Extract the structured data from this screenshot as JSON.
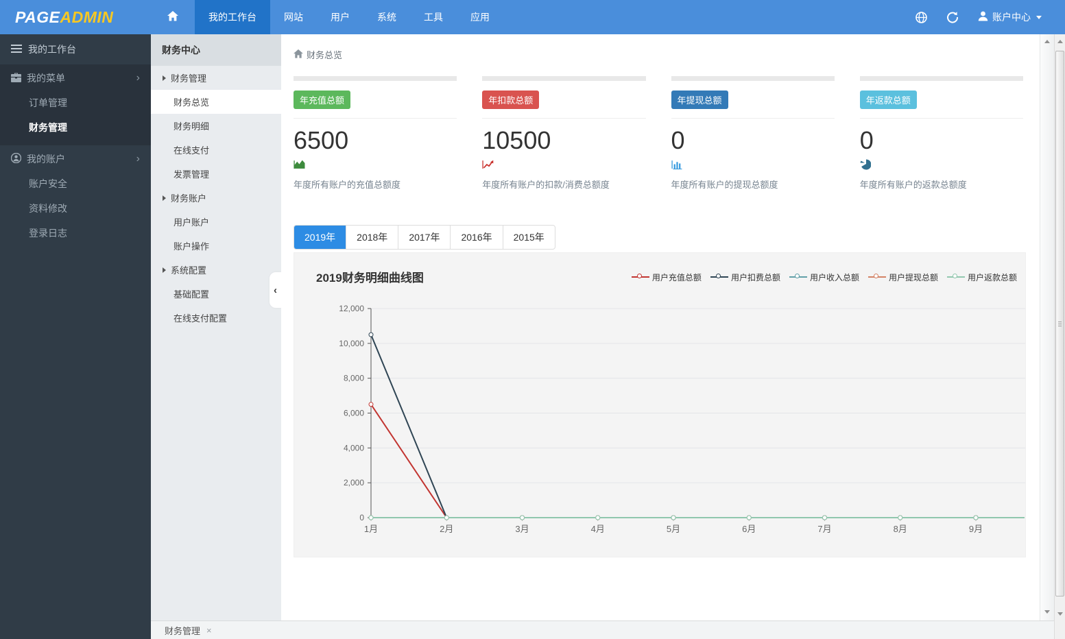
{
  "topbar": {
    "logo": {
      "page": "PAGE",
      "admin": "ADMIN"
    },
    "nav": [
      {
        "label": "我的工作台",
        "active": true
      },
      {
        "label": "网站"
      },
      {
        "label": "用户"
      },
      {
        "label": "系统"
      },
      {
        "label": "工具"
      },
      {
        "label": "应用"
      }
    ],
    "account_label": "账户中心"
  },
  "sidebar": {
    "header": "我的工作台",
    "groups": [
      {
        "label": "我的菜单",
        "items": [
          {
            "label": "订单管理"
          },
          {
            "label": "财务管理",
            "active": true
          }
        ]
      },
      {
        "label": "我的账户",
        "items": [
          {
            "label": "账户安全"
          },
          {
            "label": "资料修改"
          },
          {
            "label": "登录日志"
          }
        ]
      }
    ]
  },
  "submenu": {
    "header": "财务中心",
    "items": [
      {
        "label": "财务管理",
        "section": true
      },
      {
        "label": "财务总览",
        "active": true
      },
      {
        "label": "财务明细"
      },
      {
        "label": "在线支付"
      },
      {
        "label": "发票管理"
      },
      {
        "label": "财务账户",
        "section": true
      },
      {
        "label": "用户账户"
      },
      {
        "label": "账户操作"
      },
      {
        "label": "系统配置",
        "section": true
      },
      {
        "label": "基础配置"
      },
      {
        "label": "在线支付配置"
      }
    ]
  },
  "breadcrumb": {
    "label": "财务总览"
  },
  "cards": [
    {
      "badge": "年充值总额",
      "badge_color": "#5cb85c",
      "value": "6500",
      "icon": "area-chart-icon",
      "icon_color": "#3d8b3d",
      "desc": "年度所有账户的充值总额度"
    },
    {
      "badge": "年扣款总额",
      "badge_color": "#d9534f",
      "value": "10500",
      "icon": "trend-chart-icon",
      "icon_color": "#c9302c",
      "desc": "年度所有账户的扣款/消费总额度"
    },
    {
      "badge": "年提现总额",
      "badge_color": "#337ab7",
      "value": "0",
      "icon": "bar-chart-icon",
      "icon_color": "#3097de",
      "desc": "年度所有账户的提现总额度"
    },
    {
      "badge": "年返款总额",
      "badge_color": "#5bc0de",
      "value": "0",
      "icon": "pie-chart-icon",
      "icon_color": "#31708f",
      "desc": "年度所有账户的返款总额度"
    }
  ],
  "tabs": [
    {
      "label": "2019年",
      "active": true
    },
    {
      "label": "2018年"
    },
    {
      "label": "2017年"
    },
    {
      "label": "2016年"
    },
    {
      "label": "2015年"
    }
  ],
  "chart_data": {
    "type": "line",
    "title": "2019财务明细曲线图",
    "categories": [
      "1月",
      "2月",
      "3月",
      "4月",
      "5月",
      "6月",
      "7月",
      "8月",
      "9月"
    ],
    "series": [
      {
        "name": "用户充值总额",
        "color": "#c23531",
        "values": [
          6500,
          0,
          0,
          0,
          0,
          0,
          0,
          0,
          0
        ]
      },
      {
        "name": "用户扣费总额",
        "color": "#2f4554",
        "values": [
          10500,
          0,
          0,
          0,
          0,
          0,
          0,
          0,
          0
        ]
      },
      {
        "name": "用户收入总额",
        "color": "#61a0a8",
        "values": [
          0,
          0,
          0,
          0,
          0,
          0,
          0,
          0,
          0
        ]
      },
      {
        "name": "用户提现总额",
        "color": "#d48265",
        "values": [
          0,
          0,
          0,
          0,
          0,
          0,
          0,
          0,
          0
        ]
      },
      {
        "name": "用户返款总额",
        "color": "#91c7ae",
        "values": [
          0,
          0,
          0,
          0,
          0,
          0,
          0,
          0,
          0
        ]
      }
    ],
    "ylim": [
      0,
      12000
    ],
    "ytick_step": 2000,
    "xlabel": "",
    "ylabel": "",
    "grid": true,
    "legend_position": "top-right"
  },
  "bottom_tab": {
    "label": "财务管理",
    "close": "×"
  },
  "colors": {
    "topbar": "#4a8edb",
    "topbar_active": "#2173c8",
    "logo_accent": "#f7c823",
    "sidebar_bg": "#303c47",
    "submenu_bg": "#e9ecef",
    "tab_active": "#2d8ce4",
    "panel_bg": "#f4f4f4"
  }
}
